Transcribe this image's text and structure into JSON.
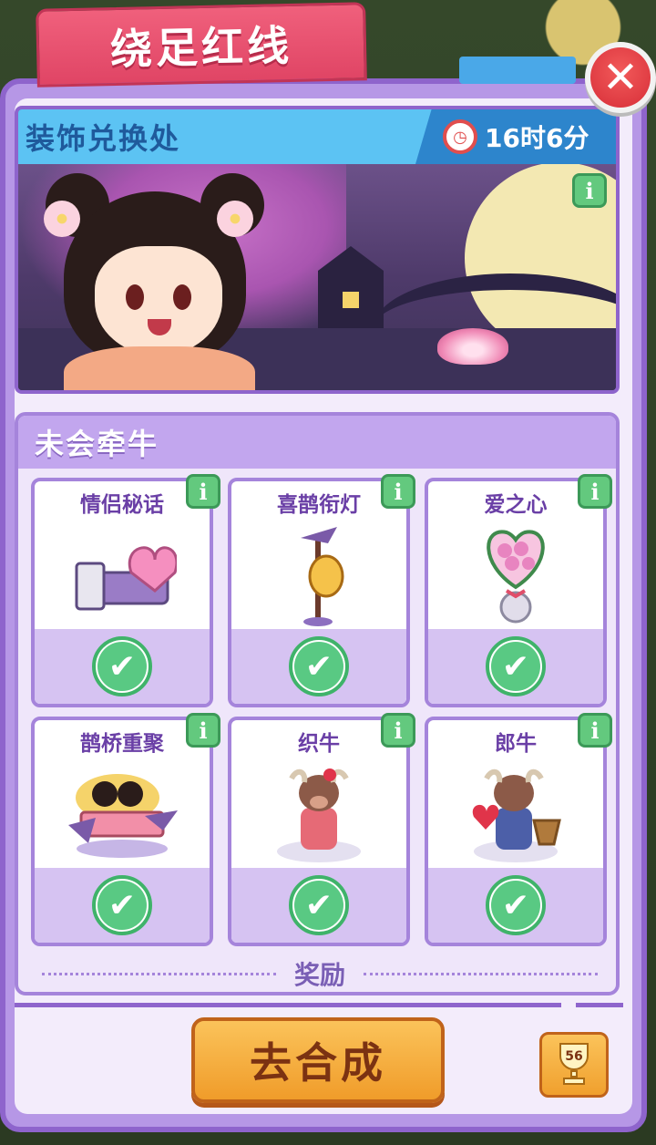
{
  "window": {
    "title": "绕足红线",
    "close_icon": "close-icon"
  },
  "banner": {
    "title": "装饰兑换处",
    "timer": "16时6分",
    "info_label": "i"
  },
  "section": {
    "title": "未会牵牛",
    "items": [
      {
        "name": "情侣秘话",
        "icon": "heart-bed-icon",
        "info": "i",
        "check": "✔"
      },
      {
        "name": "喜鹊衔灯",
        "icon": "magpie-lantern-icon",
        "info": "i",
        "check": "✔"
      },
      {
        "name": "爱之心",
        "icon": "heart-bouquet-icon",
        "info": "i",
        "check": "✔"
      },
      {
        "name": "鹊桥重聚",
        "icon": "magpie-bridge-icon",
        "info": "i",
        "check": "✔"
      },
      {
        "name": "织牛",
        "icon": "weaver-ox-icon",
        "info": "i",
        "check": "✔"
      },
      {
        "name": "郎牛",
        "icon": "herder-ox-icon",
        "info": "i",
        "check": "✔"
      }
    ],
    "reward_label": "奖励"
  },
  "footer": {
    "go_button": "去合成",
    "trophy_count": "56"
  },
  "colors": {
    "title_tab": "#e04565",
    "panel_border": "#8e64cc",
    "banner_header": "#5cc3f3",
    "check_green": "#59c983",
    "button_orange": "#f09c2a"
  }
}
